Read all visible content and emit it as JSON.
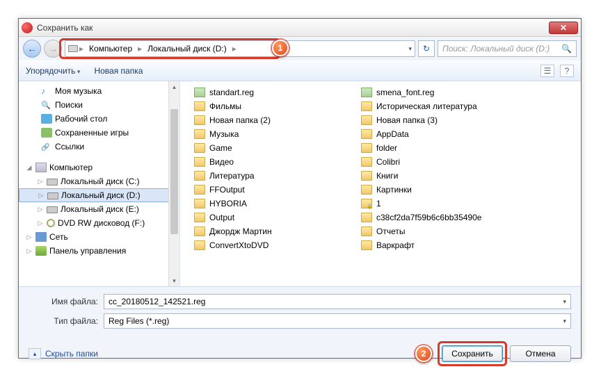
{
  "title": "Сохранить как",
  "breadcrumb": {
    "root": "Компьютер",
    "drive": "Локальный диск (D:)"
  },
  "search_placeholder": "Поиск: Локальный диск (D:)",
  "toolbar": {
    "organize": "Упорядочить",
    "newfolder": "Новая папка"
  },
  "tree": {
    "mymusic": "Моя музыка",
    "searches": "Поиски",
    "desktop": "Рабочий стол",
    "savedgames": "Сохраненные игры",
    "links": "Ссылки",
    "computer": "Компьютер",
    "driveC": "Локальный диск (C:)",
    "driveD": "Локальный диск (D:)",
    "driveE": "Локальный диск (E:)",
    "dvd": "DVD RW дисковод (F:)",
    "network": "Сеть",
    "cp": "Панель управления"
  },
  "files_left": [
    {
      "t": "reg",
      "n": "standart.reg"
    },
    {
      "t": "f",
      "n": "Фильмы"
    },
    {
      "t": "f",
      "n": "Новая папка (2)"
    },
    {
      "t": "f",
      "n": "Музыка"
    },
    {
      "t": "f",
      "n": "Game"
    },
    {
      "t": "f",
      "n": "Видео"
    },
    {
      "t": "f",
      "n": "Литература"
    },
    {
      "t": "f",
      "n": "FFOutput"
    },
    {
      "t": "f",
      "n": "HYBORIA"
    },
    {
      "t": "f",
      "n": "Output"
    },
    {
      "t": "f",
      "n": "Джордж Мартин"
    },
    {
      "t": "f",
      "n": "ConvertXtoDVD"
    }
  ],
  "files_right": [
    {
      "t": "reg",
      "n": "smena_font.reg"
    },
    {
      "t": "f",
      "n": "Историческая литература"
    },
    {
      "t": "f",
      "n": "Новая папка (3)"
    },
    {
      "t": "f",
      "n": "AppData"
    },
    {
      "t": "f",
      "n": "folder"
    },
    {
      "t": "f",
      "n": "Colibri"
    },
    {
      "t": "f",
      "n": "Книги"
    },
    {
      "t": "f",
      "n": "Картинки"
    },
    {
      "t": "lock",
      "n": "1"
    },
    {
      "t": "f",
      "n": "c38cf2da7f59b6c6bb35490e"
    },
    {
      "t": "f",
      "n": "Отчеты"
    },
    {
      "t": "f",
      "n": "Варкрафт"
    }
  ],
  "labels": {
    "filename": "Имя файла:",
    "filetype": "Тип файла:"
  },
  "filename_value": "cc_20180512_142521.reg",
  "filetype_value": "Reg Files (*.reg)",
  "hide_folders": "Скрыть папки",
  "buttons": {
    "save": "Сохранить",
    "cancel": "Отмена"
  },
  "markers": {
    "m1": "1",
    "m2": "2"
  }
}
